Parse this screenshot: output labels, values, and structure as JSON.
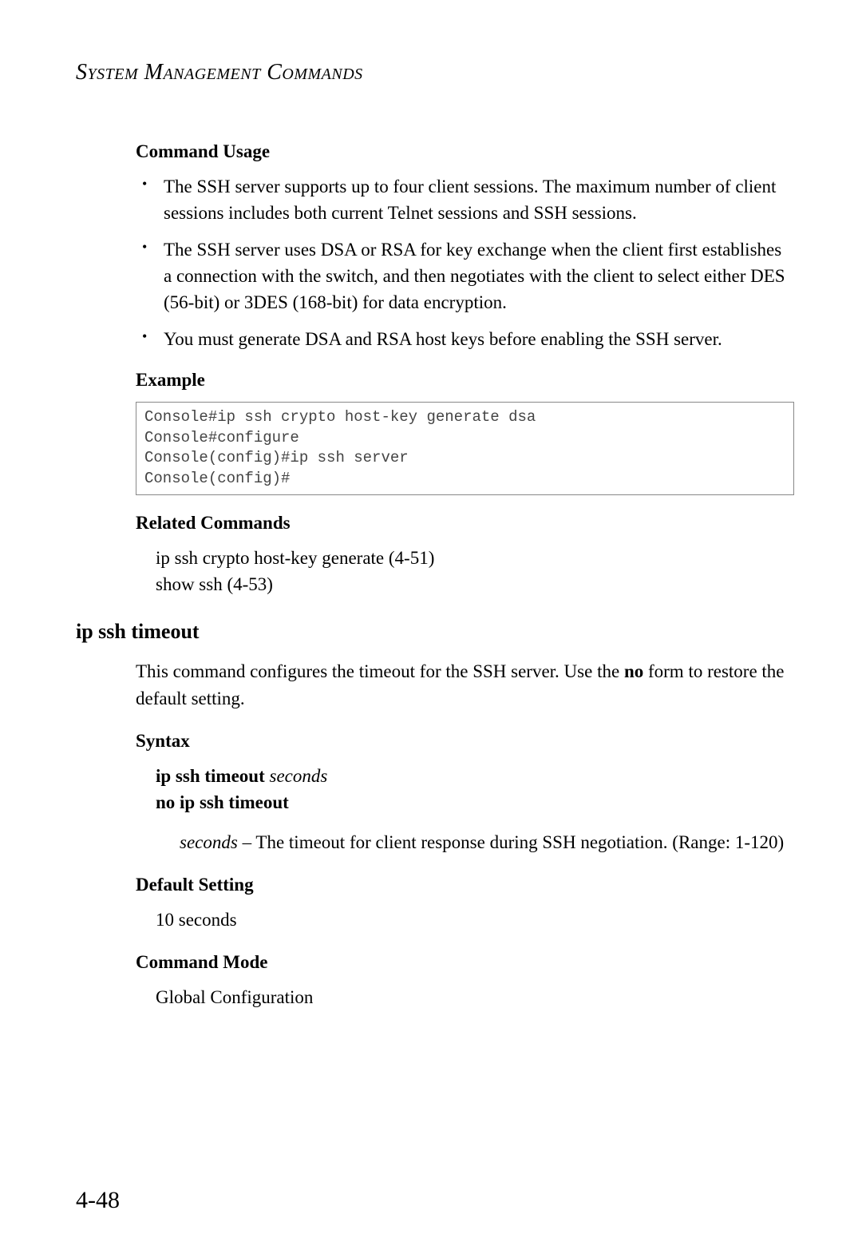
{
  "header": {
    "title": "System Management Commands"
  },
  "section1": {
    "command_usage_heading": "Command Usage",
    "bullets": {
      "b1": "The SSH server supports up to four client sessions. The maximum number of client sessions includes both current Telnet sessions and SSH sessions.",
      "b2": "The SSH server uses DSA or RSA for key exchange when the client first establishes a connection with the switch, and then negotiates with the client to select either DES (56-bit) or 3DES (168-bit) for data encryption.",
      "b3": "You must generate DSA and RSA host keys before enabling the SSH server."
    },
    "example_heading": "Example",
    "example_code": "Console#ip ssh crypto host-key generate dsa\nConsole#configure\nConsole(config)#ip ssh server\nConsole(config)#",
    "related_heading": "Related Commands",
    "related_line1": "ip ssh crypto host-key generate (4-51)",
    "related_line2": "show ssh (4-53)"
  },
  "section2": {
    "title": "ip ssh timeout",
    "intro_pre": "This command configures the timeout for the SSH server. Use the ",
    "intro_bold": "no",
    "intro_post": " form to restore the default setting.",
    "syntax_heading": "Syntax",
    "syntax_bold1": "ip ssh timeout ",
    "syntax_italic1": "seconds",
    "syntax_bold2": "no ip ssh timeout",
    "param_italic": "seconds",
    "param_rest": " – The timeout for client response during SSH negotiation. (Range: 1-120)",
    "default_heading": "Default Setting",
    "default_value": "10 seconds",
    "mode_heading": "Command Mode",
    "mode_value": "Global Configuration"
  },
  "page_number": "4-48"
}
